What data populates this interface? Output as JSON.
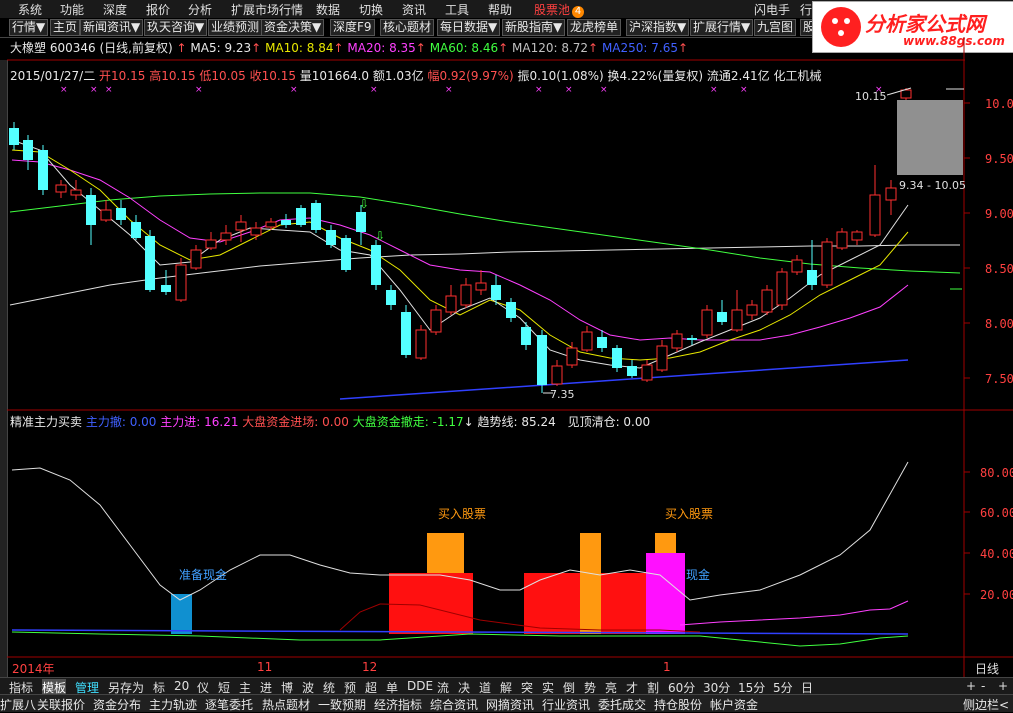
{
  "menubar": {
    "items": [
      "系统",
      "功能",
      "深度",
      "报价",
      "分析",
      "扩展市场行情",
      "数据",
      "切换",
      "资讯",
      "工具",
      "帮助"
    ],
    "special": "股票池",
    "special_badge": "4",
    "right_items": [
      "闪电手",
      "行"
    ]
  },
  "toolbar": {
    "buttons": [
      "行情▼",
      "主页",
      "新闻资讯▼",
      "玖天咨询▼",
      "业绩预测",
      "资金决策▼",
      "深度F9",
      "核心题材",
      "每日数据▼",
      "新股指南▼",
      "龙虎榜单",
      "沪深指数▼",
      "扩展行情▼",
      "九宫图",
      "股"
    ]
  },
  "logo": {
    "title": "分析家公式网",
    "url": "www.88gs.com"
  },
  "stock_header": {
    "name": "大橡塑",
    "code": "600346",
    "mode": "(日线,前复权)",
    "ma5": "MA5: 9.23",
    "ma10": "MA10: 8.84",
    "ma20": "MA20: 8.35",
    "ma60": "MA60: 8.46",
    "ma120": "MA120: 8.72",
    "ma250": "MA250: 7.65"
  },
  "quote_line": {
    "date": "2015/01/27/二",
    "open": "开10.15",
    "high": "高10.15",
    "low": "低10.05",
    "close": "收10.15",
    "volume": "量101664.0",
    "amount": "额1.03亿",
    "change": "幅0.92(9.97%)",
    "amplitude": "振0.10(1.08%)",
    "turnover": "换4.22%(量复权)",
    "float": "流通2.41亿",
    "industry": "化工机械"
  },
  "price_axis": {
    "labels": [
      "10.00",
      "9.50",
      "9.00",
      "8.50",
      "8.00",
      "7.50"
    ]
  },
  "annotations": {
    "high_label": "10.15",
    "low_label": "7.35",
    "range_label": "9.34 - 10.05"
  },
  "indicator_header": {
    "name": "精准主力买卖",
    "main_retreat": "主力撤: 0.00",
    "main_enter": "主力进: 16.21",
    "market_in": "大盘资金进场: 0.00",
    "market_out": "大盘资金撤走: -1.17",
    "trend": "趋势线: 85.24",
    "top_clear": "见顶清仓: 0.00"
  },
  "indicator_axis": {
    "labels": [
      "80.00",
      "60.00",
      "40.00",
      "20.00"
    ]
  },
  "indicator_texts": {
    "prepare_cash": "准备现金",
    "buy_stock": "买入股票",
    "cash_partial": "现金"
  },
  "date_axis": {
    "year": "2014年",
    "m1": "11",
    "m2": "12",
    "m3": "1",
    "period": "日线"
  },
  "tabs": [
    "指标",
    "模板",
    "管理",
    "另存为",
    "标",
    "20",
    "仪",
    "短",
    "主",
    "进",
    "博",
    "波",
    "统",
    "预",
    "超",
    "单",
    "DDE",
    "流",
    "决",
    "道",
    "解",
    "突",
    "实",
    "倒",
    "势",
    "亮",
    "才",
    "割",
    "60分",
    "30分",
    "15分",
    "5分",
    "日"
  ],
  "tab_right": [
    "+",
    "-",
    "+"
  ],
  "statusbar": {
    "items": [
      "扩展八",
      "关联报价",
      "资金分布",
      "主力轨迹",
      "逐笔委托",
      "热点题材",
      "一致预期",
      "经济指标",
      "综合资讯",
      "网摘资讯",
      "行业资讯",
      "委托成交",
      "持仓股份",
      "帐户资金"
    ],
    "right": "侧边栏<"
  },
  "colors": {
    "up": "#ff3030",
    "down": "#54ffff",
    "ma5": "#ffffff",
    "ma10": "#e8e800",
    "ma20": "#ff40ff",
    "ma60": "#40ff40",
    "ma120": "#c0c0c0",
    "ma250": "#4060ff"
  }
}
